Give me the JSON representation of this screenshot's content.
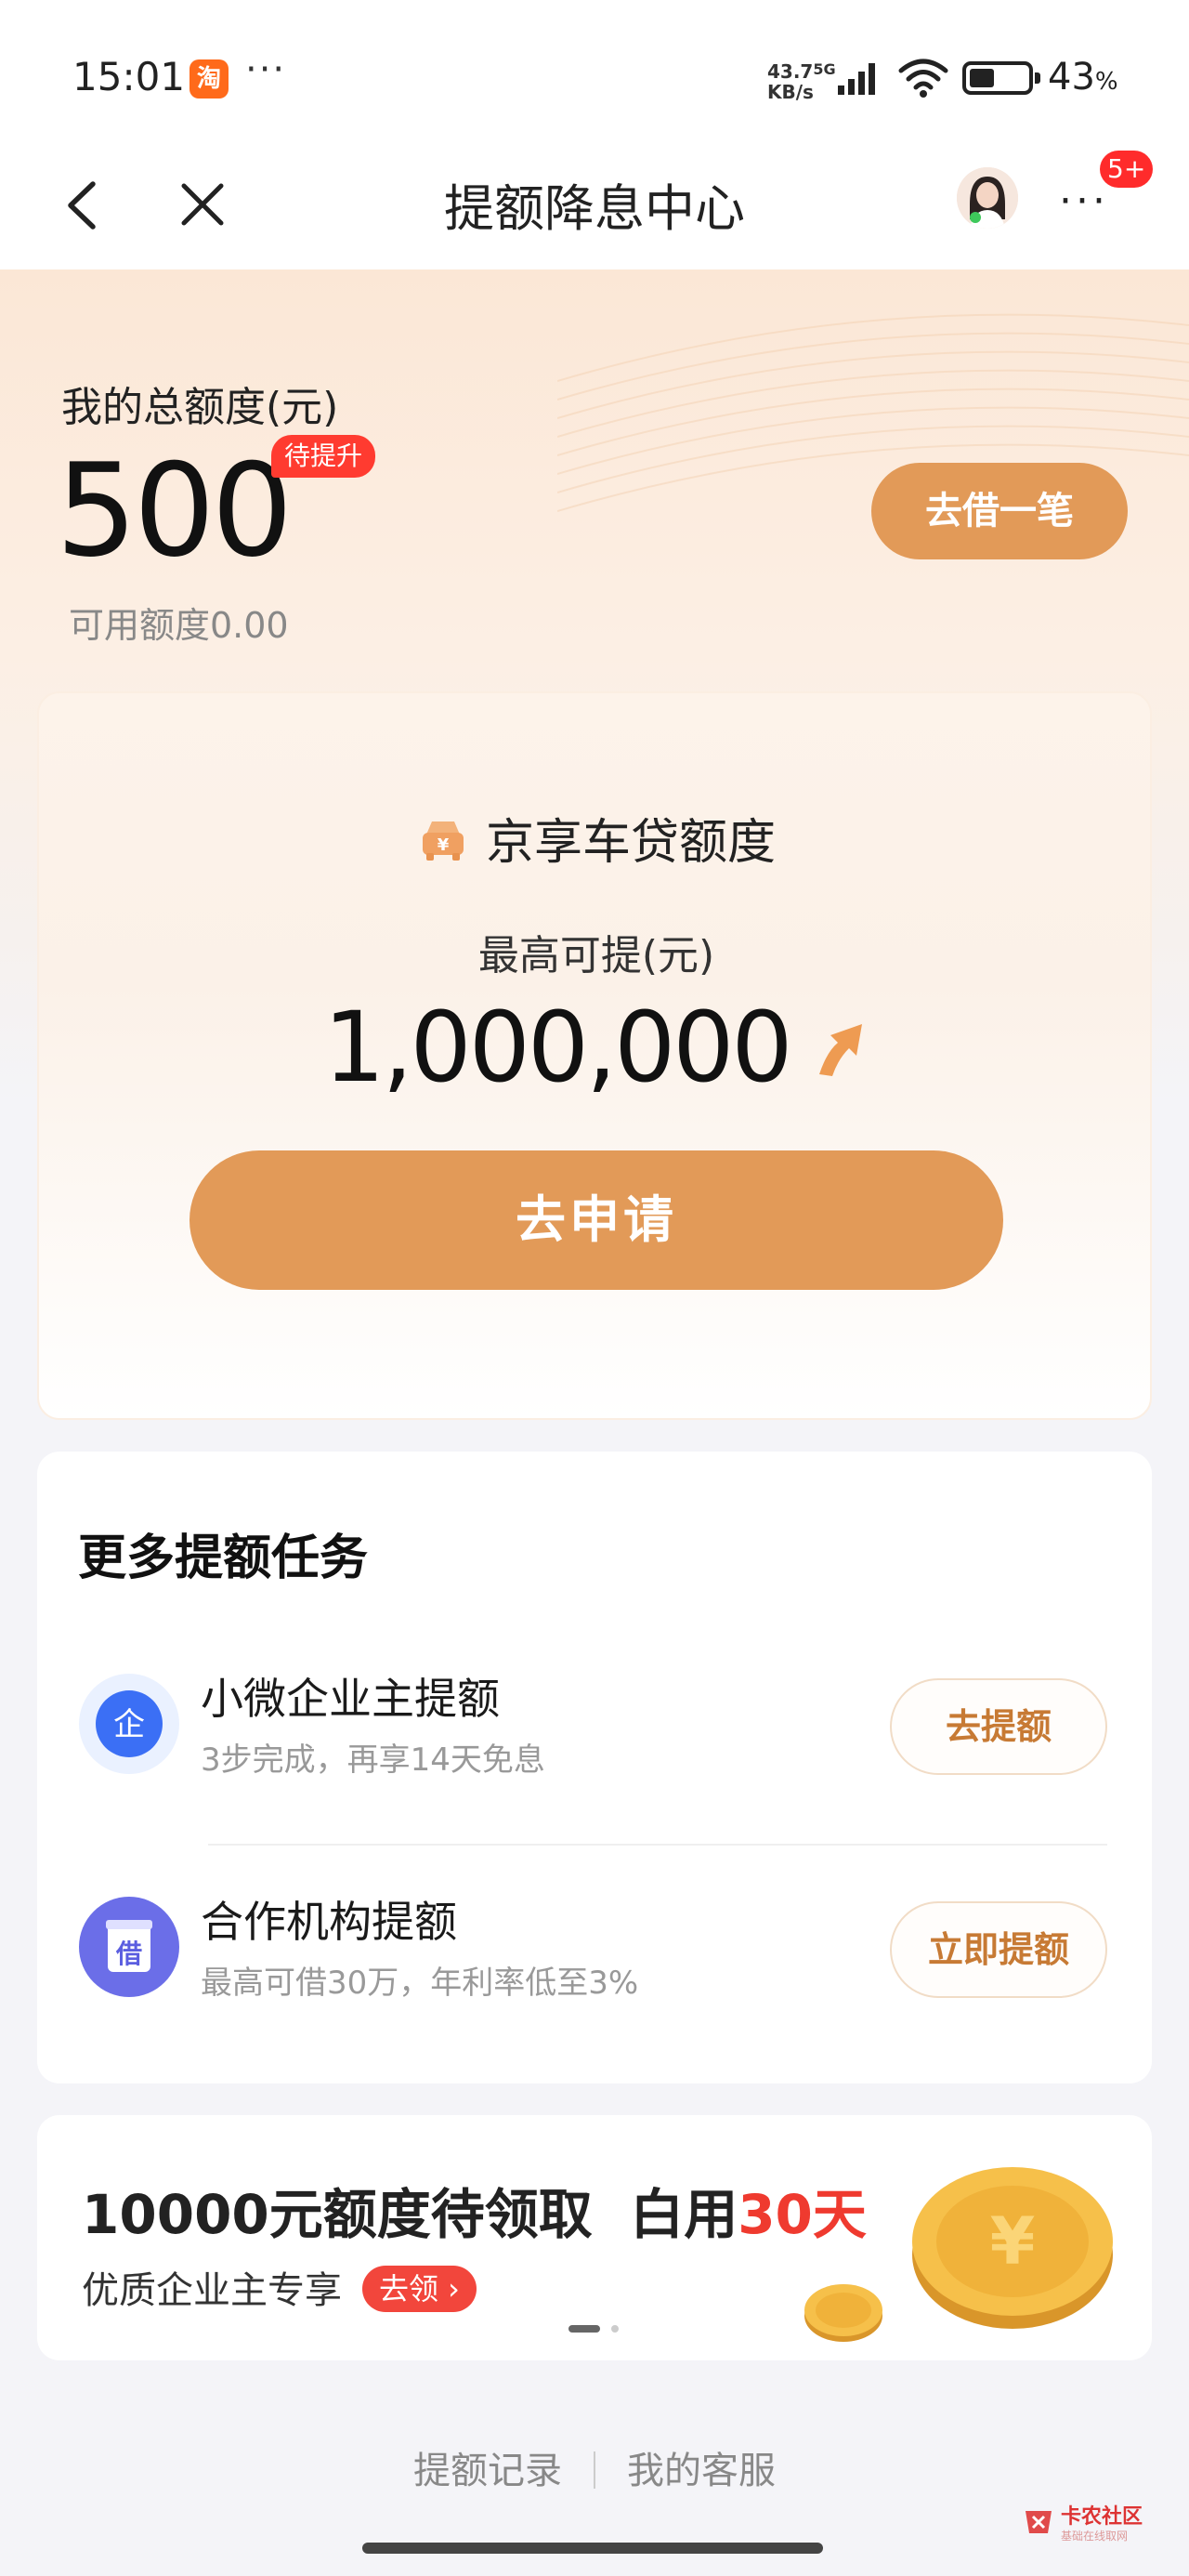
{
  "status_bar": {
    "time": "15:01",
    "app_icon_glyph": "淘",
    "more": "···",
    "net_speed_value": "43.7",
    "net_speed_unit": "KB/s",
    "network": "5G",
    "battery_pct": "43",
    "battery_unit": "%",
    "battery_level": 0.43
  },
  "nav": {
    "title": "提额降息中心",
    "more": "···",
    "badge": "5+"
  },
  "hero": {
    "label": "我的总额度(元)",
    "amount": "500",
    "tag": "待提升",
    "available": "可用额度0.00",
    "borrow_button": "去借一笔"
  },
  "car_loan": {
    "icon_glyph": "¥",
    "title": "京享车贷额度",
    "subtitle": "最高可提(元)",
    "amount": "1,000,000",
    "apply_button": "去申请"
  },
  "tasks": {
    "title": "更多提额任务",
    "items": [
      {
        "icon_glyph": "企",
        "name": "小微企业主提额",
        "desc": "3步完成，再享14天免息",
        "button": "去提额"
      },
      {
        "icon_glyph": "借",
        "name": "合作机构提额",
        "desc": "最高可借30万，年利率低至3%",
        "button": "立即提额"
      }
    ]
  },
  "promo": {
    "title_main": "10000元额度待领取",
    "title_prefix2": "白用",
    "title_accent": "30天",
    "sub": "优质企业主专享",
    "claim": "去领 ›",
    "coin_glyph": "¥"
  },
  "footer": {
    "link1": "提额记录",
    "link2": "我的客服"
  },
  "watermark": {
    "name": "卡农社区",
    "sub": "基础在线取网"
  },
  "colors": {
    "accent_orange": "#e29a58",
    "badge_red": "#ff2b2b",
    "promo_red": "#ef3a2f",
    "task_button_text": "#c77a34"
  }
}
